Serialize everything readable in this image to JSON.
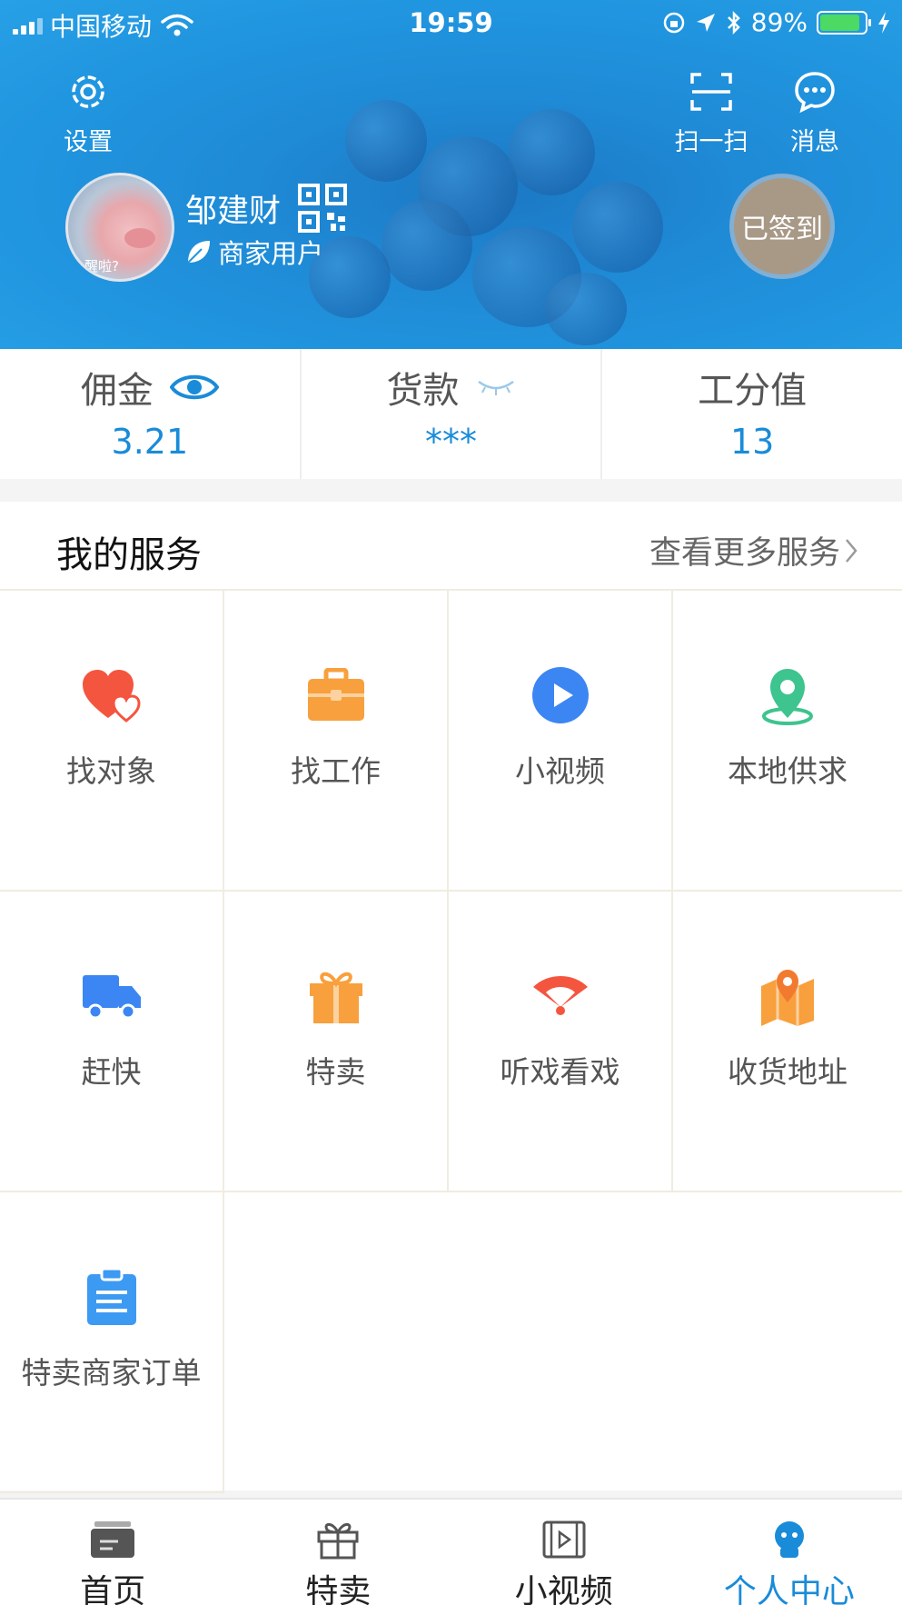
{
  "status_bar": {
    "carrier": "中国移动",
    "time": "19:59",
    "battery": "89%"
  },
  "header": {
    "settings_label": "设置",
    "scan_label": "扫一扫",
    "message_label": "消息",
    "user_name": "邹建财",
    "user_type": "商家用户",
    "avatar_caption": "醒啦?",
    "signed_label": "已签到"
  },
  "stats": [
    {
      "label": "佣金",
      "value": "3.21"
    },
    {
      "label": "货款",
      "value": "***"
    },
    {
      "label": "工分值",
      "value": "13"
    }
  ],
  "services": {
    "title": "我的服务",
    "more": "查看更多服务",
    "items": [
      {
        "label": "找对象",
        "icon": "heart-icon"
      },
      {
        "label": "找工作",
        "icon": "briefcase-icon"
      },
      {
        "label": "小视频",
        "icon": "play-icon"
      },
      {
        "label": "本地供求",
        "icon": "location-pin-icon"
      },
      {
        "label": "赶快",
        "icon": "truck-icon"
      },
      {
        "label": "特卖",
        "icon": "gift-icon"
      },
      {
        "label": "听戏看戏",
        "icon": "fan-icon"
      },
      {
        "label": "收货地址",
        "icon": "map-pin-icon"
      },
      {
        "label": "特卖商家订单",
        "icon": "clipboard-icon"
      }
    ]
  },
  "tabbar": [
    {
      "label": "首页",
      "icon": "home-icon"
    },
    {
      "label": "特卖",
      "icon": "gift-icon"
    },
    {
      "label": "小视频",
      "icon": "video-icon"
    },
    {
      "label": "个人中心",
      "icon": "profile-icon"
    }
  ],
  "colors": {
    "accent": "#1a8bd8",
    "header_bg": "#2196e0"
  }
}
